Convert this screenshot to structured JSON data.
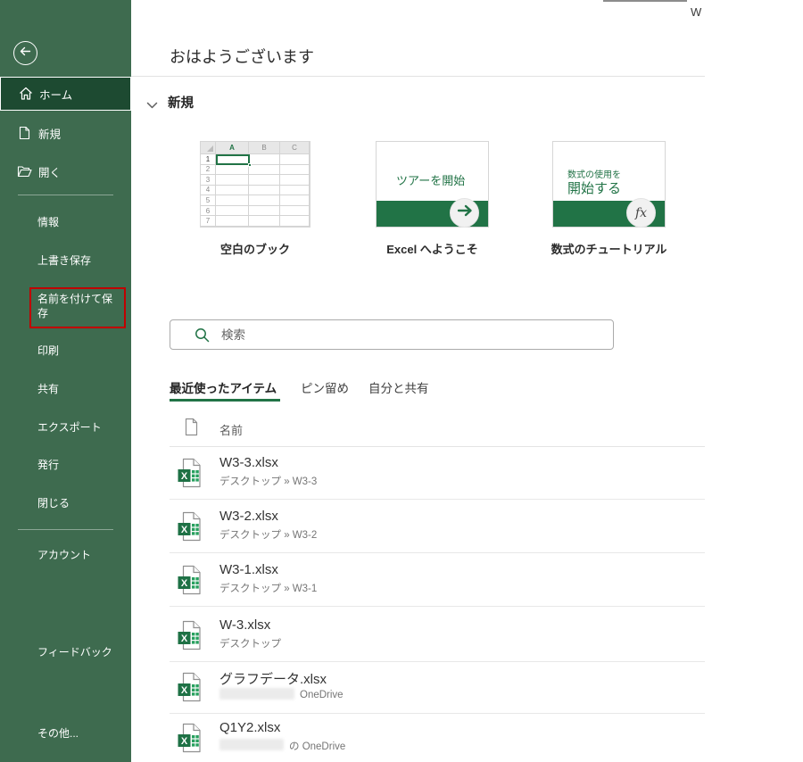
{
  "window": {
    "title_fragment": "W"
  },
  "colors": {
    "accent_green": "#217346",
    "sidebar_background": "#3E6B4F",
    "sidebar_selected": "#1D4A31",
    "annotation_red": "#C00000"
  },
  "sidebar": {
    "top_items": [
      {
        "label": "ホーム",
        "active": true
      },
      {
        "label": "新規",
        "active": false
      },
      {
        "label": "開く",
        "active": false
      }
    ],
    "mid_items": [
      {
        "label": "情報"
      },
      {
        "label": "上書き保存"
      },
      {
        "label": "名前を付けて保存",
        "annotated_red_box": true
      },
      {
        "label": "印刷"
      },
      {
        "label": "共有"
      },
      {
        "label": "エクスポート"
      },
      {
        "label": "発行"
      },
      {
        "label": "閉じる"
      }
    ],
    "bottom_items": [
      {
        "label": "アカウント"
      },
      {
        "label": "フィードバック"
      },
      {
        "label": "その他..."
      }
    ]
  },
  "main": {
    "greeting": "おはようございます",
    "new_section": {
      "title": "新規",
      "blank_preview": {
        "col_headers": [
          "A",
          "B",
          "C"
        ],
        "row_numbers": [
          "1",
          "2",
          "3",
          "4",
          "5",
          "6",
          "7"
        ]
      },
      "templates": [
        {
          "caption": "空白のブック"
        },
        {
          "caption": "Excel へようこそ",
          "preview_text": "ツアーを開始"
        },
        {
          "caption": "数式のチュートリアル",
          "preview_line1": "数式の使用を",
          "preview_line2": "開始する",
          "fx_glyph": "fx"
        }
      ]
    },
    "search": {
      "placeholder": "検索"
    },
    "tabs": [
      {
        "label": "最近使ったアイテム",
        "active": true
      },
      {
        "label": "ピン留め",
        "active": false
      },
      {
        "label": "自分と共有",
        "active": false
      }
    ],
    "files": {
      "name_header": "名前",
      "rows": [
        {
          "name": "W3-3.xlsx",
          "path": "デスクトップ » W3-3",
          "redacted": false
        },
        {
          "name": "W3-2.xlsx",
          "path": "デスクトップ » W3-2",
          "redacted": false
        },
        {
          "name": "W3-1.xlsx",
          "path": "デスクトップ » W3-1",
          "redacted": false
        },
        {
          "name": "W-3.xlsx",
          "path": "デスクトップ",
          "redacted": false
        },
        {
          "name": "グラフデータ.xlsx",
          "path": "OneDrive",
          "redacted": true
        },
        {
          "name": "Q1Y2.xlsx",
          "path": "の OneDrive",
          "redacted": true
        }
      ]
    }
  }
}
